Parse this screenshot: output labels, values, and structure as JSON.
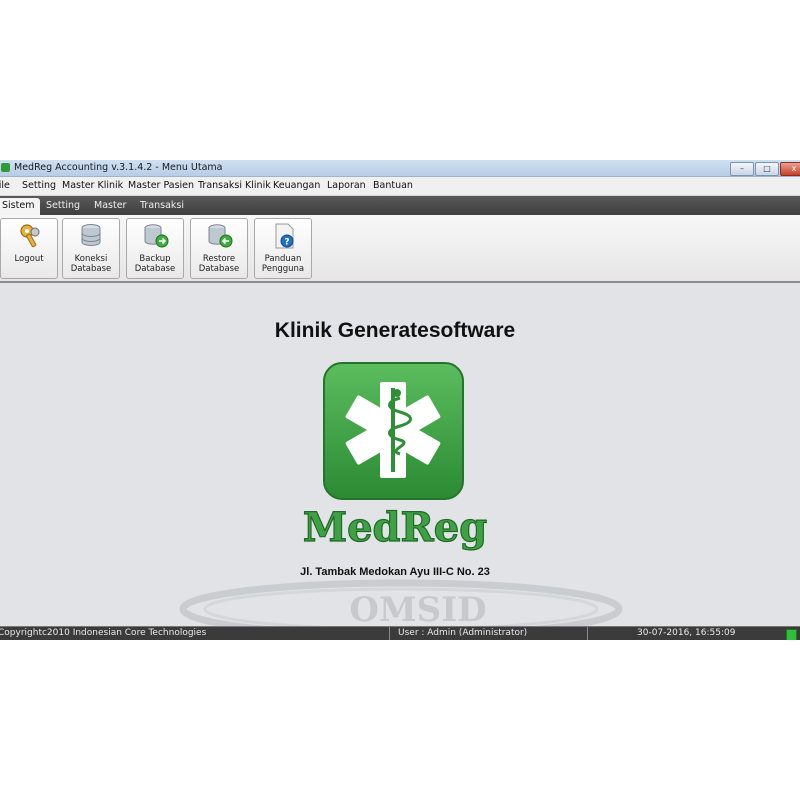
{
  "window": {
    "title": "MedReg Accounting v.3.1.4.2 - Menu Utama",
    "buttons": {
      "minimize": "–",
      "maximize": "□",
      "close": "x"
    }
  },
  "menu": [
    {
      "label": "File"
    },
    {
      "label": "Setting"
    },
    {
      "label": "Master Klinik"
    },
    {
      "label": "Master Pasien"
    },
    {
      "label": "Transaksi Klinik"
    },
    {
      "label": "Keuangan"
    },
    {
      "label": "Laporan"
    },
    {
      "label": "Bantuan"
    }
  ],
  "tabs": [
    {
      "label": "Sistem",
      "active": true
    },
    {
      "label": "Setting"
    },
    {
      "label": "Master"
    },
    {
      "label": "Transaksi"
    }
  ],
  "ribbon": [
    {
      "label": "Logout",
      "icon": "keys-icon"
    },
    {
      "label": "Koneksi\nDatabase",
      "icon": "database-icon"
    },
    {
      "label": "Backup\nDatabase",
      "icon": "database-backup-icon"
    },
    {
      "label": "Restore\nDatabase",
      "icon": "database-restore-icon"
    },
    {
      "label": "Panduan\nPengguna",
      "icon": "help-document-icon"
    }
  ],
  "main": {
    "clinic_name": "Klinik Generatesoftware",
    "logo_text": "MedReg",
    "address": "Jl. Tambak Medokan Ayu III-C No. 23",
    "watermark_text": "OMSID"
  },
  "status": {
    "copyright": "Copyrightc2010 Indonesian Core Technologies",
    "user": "User : Admin (Administrator)",
    "datetime": "30-07-2016, 16:55:09"
  },
  "colors": {
    "brand_green": "#3fa046",
    "status_bar": "#3b3b3b",
    "tab_bar": "#4a4a4a"
  }
}
